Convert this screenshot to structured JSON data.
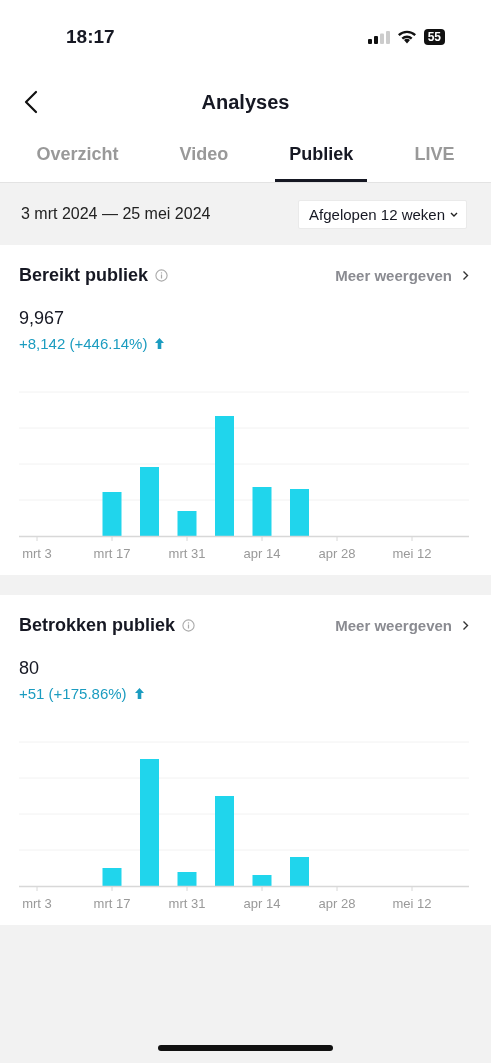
{
  "status_bar": {
    "time": "18:17",
    "battery": "55"
  },
  "header": {
    "title": "Analyses"
  },
  "tabs": [
    {
      "label": "Overzicht",
      "selected": false
    },
    {
      "label": "Video",
      "selected": false
    },
    {
      "label": "Publiek",
      "selected": true
    },
    {
      "label": "LIVE",
      "selected": false
    }
  ],
  "date_range": {
    "range": "3 mrt 2024 — 25 mei 2024",
    "period": "Afgelopen 12 weken"
  },
  "cards": [
    {
      "title": "Bereikt publiek",
      "more": "Meer weergeven",
      "value": "9,967",
      "change": "+8,142 (+446.14%)",
      "x_labels": [
        "mrt 3",
        "mrt 17",
        "mrt 31",
        "apr 14",
        "apr 28",
        "mei 12"
      ]
    },
    {
      "title": "Betrokken publiek",
      "more": "Meer weergeven",
      "value": "80",
      "change": "+51 (+175.86%)",
      "x_labels": [
        "mrt 3",
        "mrt 17",
        "mrt 31",
        "apr 14",
        "apr 28",
        "mei 12"
      ]
    }
  ]
}
